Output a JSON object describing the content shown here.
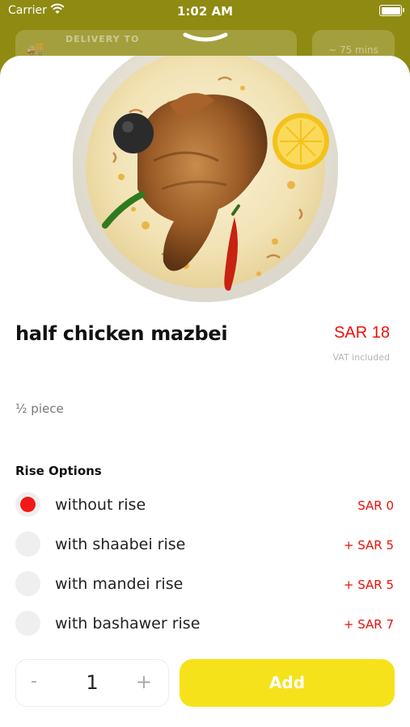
{
  "status_bar": {
    "carrier": "Carrier",
    "time": "1:02 AM"
  },
  "background": {
    "delivery_label": "DELIVERY TO",
    "eta": "~ 75 mins"
  },
  "product": {
    "name": "half chicken mazbei",
    "price": "SAR 18",
    "vat_note": "VAT included",
    "description": "½ piece"
  },
  "options": {
    "title": "Rise Options",
    "items": [
      {
        "label": "without rise",
        "price": "SAR 0",
        "selected": true
      },
      {
        "label": "with shaabei rise",
        "price": "+ SAR 5",
        "selected": false
      },
      {
        "label": "with mandei rise",
        "price": "+ SAR 5",
        "selected": false
      },
      {
        "label": "with bashawer rise",
        "price": "+ SAR 7",
        "selected": false
      }
    ]
  },
  "quantity": {
    "minus": "-",
    "value": "1",
    "plus": "+"
  },
  "add_button": {
    "label": "Add"
  },
  "colors": {
    "accent_red": "#e8120c",
    "add_yellow": "#f6e21a",
    "backdrop": "#8f8a12"
  }
}
